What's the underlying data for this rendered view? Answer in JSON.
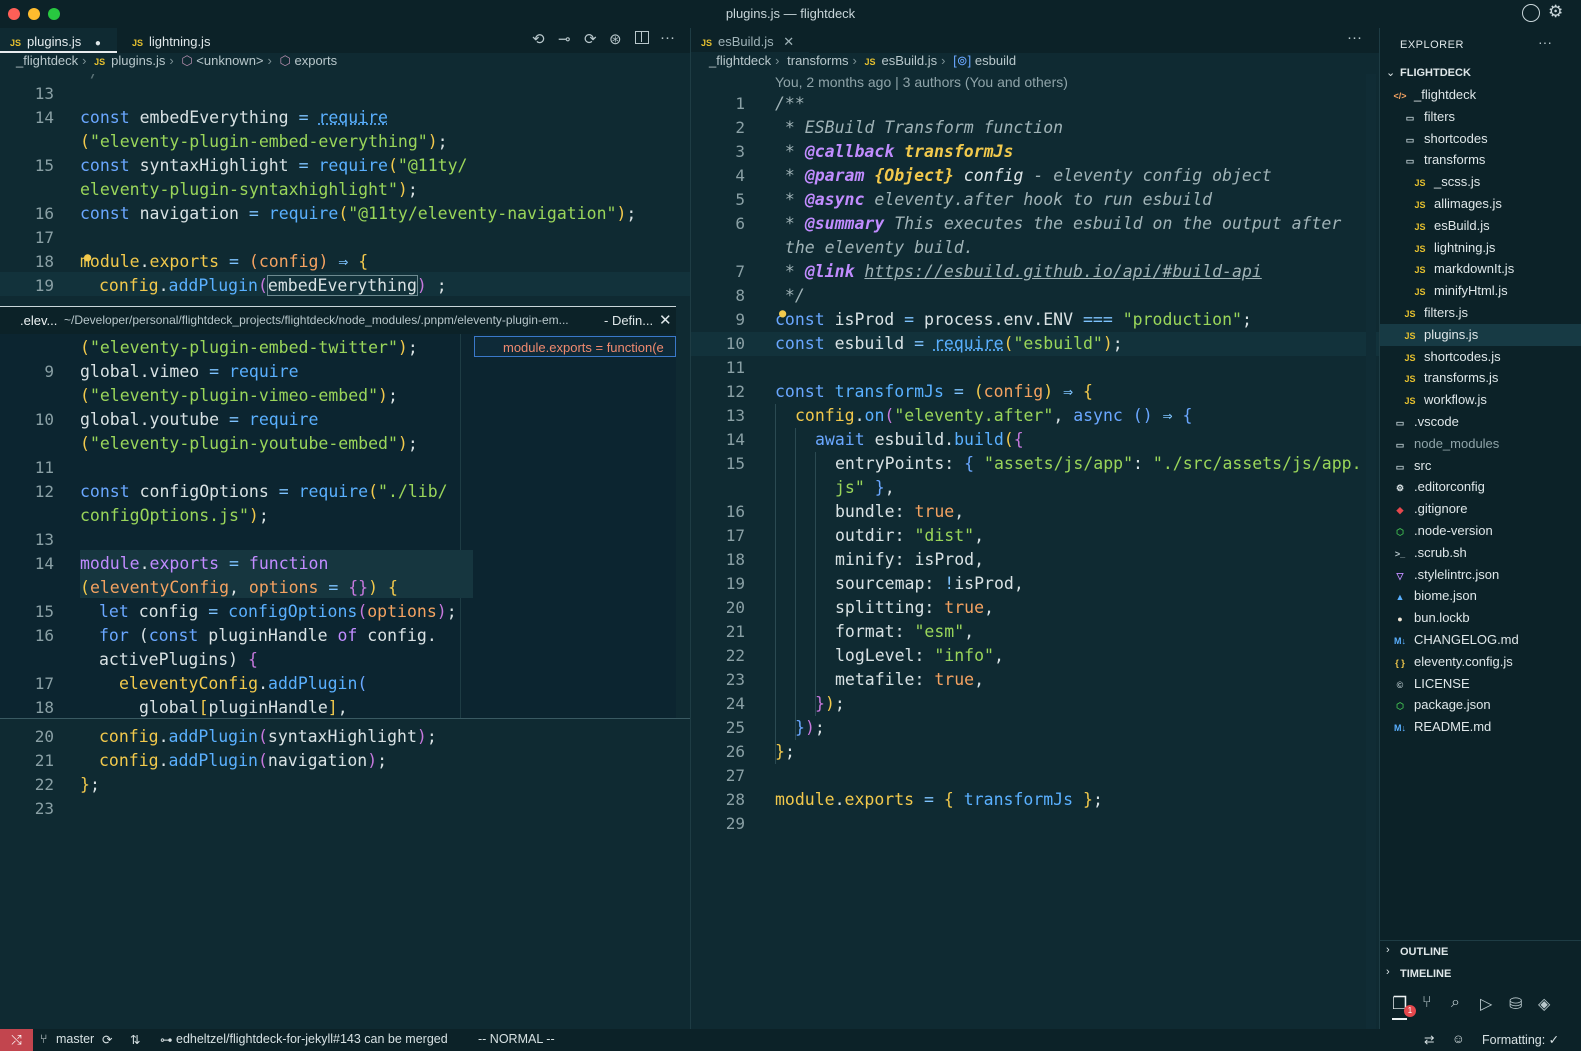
{
  "window": {
    "title": "plugins.js — flightdeck"
  },
  "left_editor": {
    "tabs": [
      {
        "label": "plugins.js",
        "badge": "JS",
        "modified_dot": "●"
      },
      {
        "label": "lightning.js",
        "badge": "JS"
      }
    ],
    "breadcrumb": [
      "_flightdeck",
      "plugins.js",
      "<unknown>",
      "exports"
    ],
    "breadcrumb_file_badge": "JS",
    "peek_header": {
      "file": ".elev...",
      "path": "~/Developer/personal/flightdeck_projects/flightdeck/node_modules/.pnpm/eleventy-plugin-em...",
      "kind": "- Defin...",
      "result": "module.exports = function(e"
    },
    "top_lines": [
      {
        "n": "13"
      },
      {
        "n": "14"
      },
      {
        "n": ""
      },
      {
        "n": "15"
      },
      {
        "n": ""
      },
      {
        "n": "16"
      },
      {
        "n": "17"
      },
      {
        "n": "18"
      },
      {
        "n": "19"
      }
    ],
    "peek_line_numbers": [
      "",
      "9",
      "",
      "10",
      "",
      "11",
      "12",
      "",
      "13",
      "14",
      "",
      "15",
      "16",
      "",
      "17",
      "18"
    ],
    "bottom_line_numbers": [
      "20",
      "21",
      "22",
      "23"
    ]
  },
  "right_editor": {
    "tab": {
      "label": "esBuild.js",
      "badge": "JS"
    },
    "breadcrumb": [
      "_flightdeck",
      "transforms",
      "esBuild.js",
      "esbuild"
    ],
    "breadcrumb_file_badge": "JS",
    "blame": "You, 2 months ago | 3 authors (You and others)",
    "line_numbers": [
      "1",
      "2",
      "3",
      "4",
      "5",
      "6",
      "",
      "7",
      "8",
      "9",
      "10",
      "11",
      "12",
      "13",
      "14",
      "15",
      "",
      "16",
      "17",
      "18",
      "19",
      "20",
      "21",
      "22",
      "23",
      "24",
      "25",
      "26",
      "27",
      "28",
      "29"
    ]
  },
  "explorer": {
    "header": "EXPLORER",
    "more": "···",
    "root": "FLIGHTDECK",
    "items": [
      {
        "label": "_flightdeck",
        "icon": "</>",
        "depth": 0
      },
      {
        "label": "filters",
        "icon": "folder",
        "depth": 1
      },
      {
        "label": "shortcodes",
        "icon": "folder",
        "depth": 1
      },
      {
        "label": "transforms",
        "icon": "folder",
        "depth": 1
      },
      {
        "label": "_scss.js",
        "icon": "JS",
        "depth": 2
      },
      {
        "label": "allimages.js",
        "icon": "JS",
        "depth": 2
      },
      {
        "label": "esBuild.js",
        "icon": "JS",
        "depth": 2
      },
      {
        "label": "lightning.js",
        "icon": "JS",
        "depth": 2
      },
      {
        "label": "markdownIt.js",
        "icon": "JS",
        "depth": 2
      },
      {
        "label": "minifyHtml.js",
        "icon": "JS",
        "depth": 2
      },
      {
        "label": "filters.js",
        "icon": "JS",
        "depth": 1
      },
      {
        "label": "plugins.js",
        "icon": "JS",
        "depth": 1,
        "selected": true
      },
      {
        "label": "shortcodes.js",
        "icon": "JS",
        "depth": 1
      },
      {
        "label": "transforms.js",
        "icon": "JS",
        "depth": 1
      },
      {
        "label": "workflow.js",
        "icon": "JS",
        "depth": 1
      },
      {
        "label": ".vscode",
        "icon": "folder",
        "depth": 0
      },
      {
        "label": "node_modules",
        "icon": "folder",
        "depth": 0,
        "dim": true
      },
      {
        "label": "src",
        "icon": "folder",
        "depth": 0
      },
      {
        "label": ".editorconfig",
        "icon": "gear",
        "depth": 0
      },
      {
        "label": ".gitignore",
        "icon": "git",
        "depth": 0
      },
      {
        "label": ".node-version",
        "icon": "hex",
        "depth": 0
      },
      {
        "label": ".scrub.sh",
        "icon": ">_",
        "depth": 0
      },
      {
        "label": ".stylelintrc.json",
        "icon": "stylelint",
        "depth": 0
      },
      {
        "label": "biome.json",
        "icon": "biome",
        "depth": 0
      },
      {
        "label": "bun.lockb",
        "icon": "bun",
        "depth": 0
      },
      {
        "label": "CHANGELOG.md",
        "icon": "M↓",
        "depth": 0
      },
      {
        "label": "eleventy.config.js",
        "icon": "{ }",
        "depth": 0
      },
      {
        "label": "LICENSE",
        "icon": "©",
        "depth": 0
      },
      {
        "label": "package.json",
        "icon": "hex",
        "depth": 0
      },
      {
        "label": "README.md",
        "icon": "M↓",
        "depth": 0
      }
    ],
    "outline": "OUTLINE",
    "timeline": "TIMELINE",
    "badge_count": "1"
  },
  "status_bar": {
    "branch": "master",
    "pr": "edheltzel/flightdeck-for-jekyll#143 can be merged",
    "mode": "-- NORMAL --",
    "formatting": "Formatting: ✓"
  },
  "colors": {
    "background": "#0f2a32",
    "chrome": "#0c2228",
    "accent": "#6aa7ff",
    "string": "#9ad65a"
  }
}
